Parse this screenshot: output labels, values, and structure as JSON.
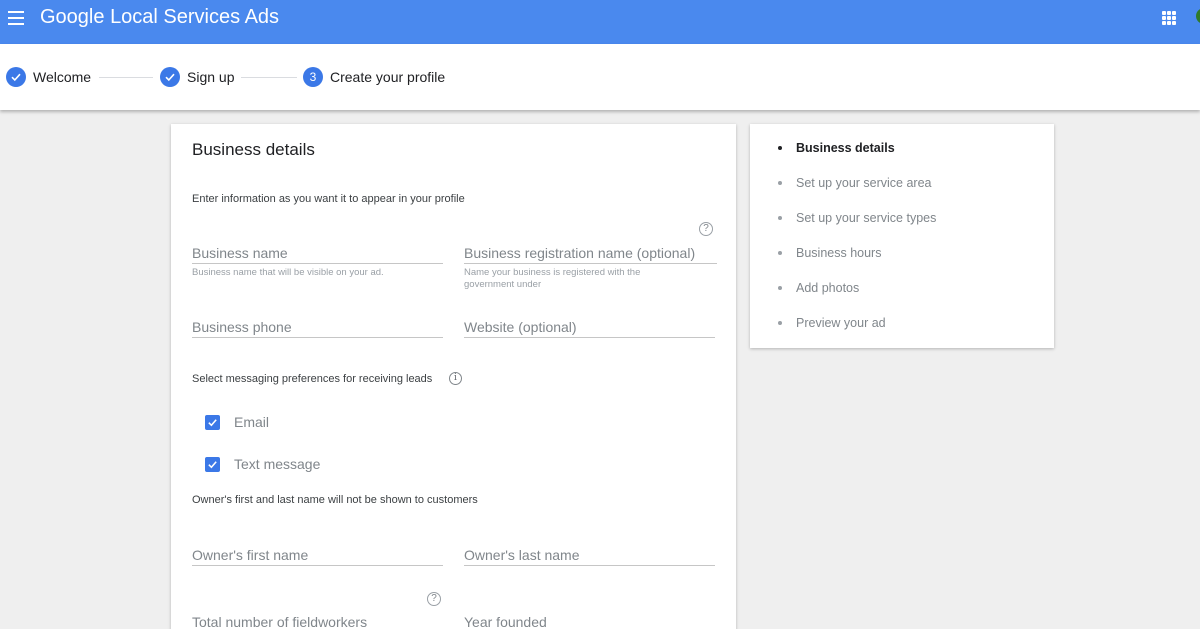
{
  "header": {
    "brand_google": "Google",
    "brand_product": "Local Services Ads",
    "bar_color": "#4a89ee"
  },
  "stepper": {
    "steps": [
      {
        "label": "Welcome",
        "state": "done",
        "icon": "check-icon"
      },
      {
        "label": "Sign up",
        "state": "done",
        "icon": "check-icon"
      },
      {
        "label": "Create your profile",
        "state": "current",
        "number": "3"
      }
    ],
    "accent": "#3b78e7"
  },
  "form": {
    "title": "Business details",
    "subtitle": "Enter information as you want it to appear in your profile",
    "business_name": {
      "placeholder": "Business name",
      "value": "",
      "hint": "Business name that will be visible on your ad."
    },
    "registration_name": {
      "placeholder": "Business registration name (optional)",
      "value": "",
      "hint": "Name your business is registered with the government under"
    },
    "business_phone": {
      "placeholder": "Business phone",
      "value": ""
    },
    "website": {
      "placeholder": "Website (optional)",
      "value": ""
    },
    "messaging_label": "Select messaging preferences for receiving leads",
    "messaging_options": [
      {
        "label": "Email",
        "checked": true
      },
      {
        "label": "Text message",
        "checked": true
      }
    ],
    "owner_note": "Owner's first and last name will not be shown to customers",
    "owner_first": {
      "placeholder": "Owner's first name",
      "value": ""
    },
    "owner_last": {
      "placeholder": "Owner's last name",
      "value": ""
    },
    "fieldworkers": {
      "placeholder": "Total number of fieldworkers",
      "value": ""
    },
    "year_founded": {
      "placeholder": "Year founded",
      "value": ""
    },
    "help_glyph": "?",
    "info_glyph": "i"
  },
  "side_nav": {
    "items": [
      {
        "label": "Business details",
        "active": true
      },
      {
        "label": "Set up your service area",
        "active": false
      },
      {
        "label": "Set up your service types",
        "active": false
      },
      {
        "label": "Business hours",
        "active": false
      },
      {
        "label": "Add photos",
        "active": false
      },
      {
        "label": "Preview your ad",
        "active": false
      }
    ]
  }
}
